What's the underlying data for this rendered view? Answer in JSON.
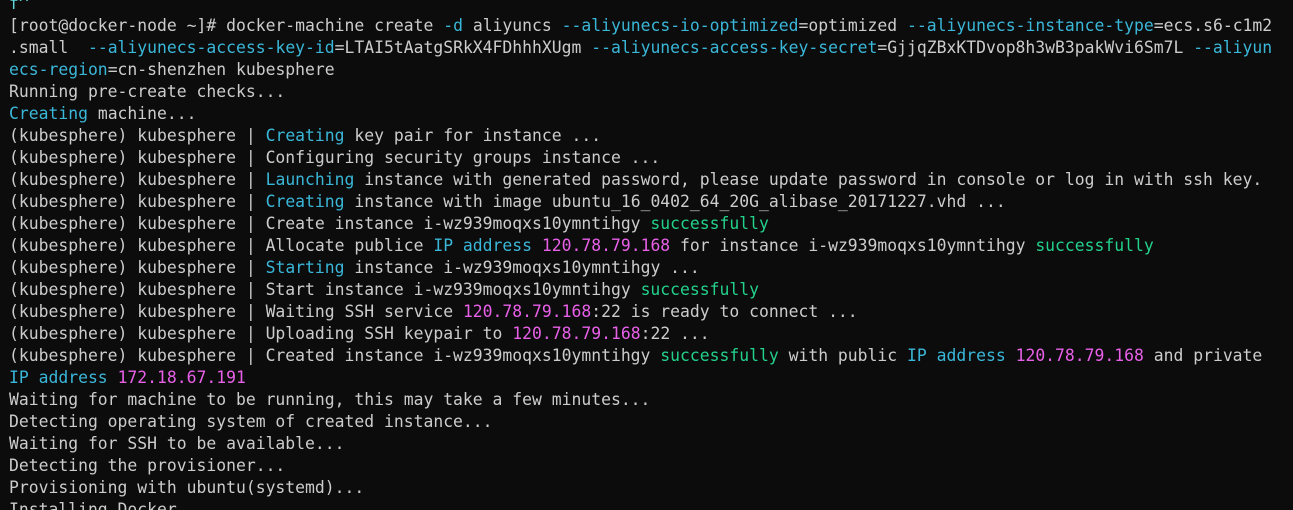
{
  "window": {
    "type": "terminal",
    "background": "#0c0c0c",
    "foreground": "#cccccc"
  },
  "colors": {
    "default": "#cccccc",
    "flag": "#3ab7d8",
    "keyword": "#3ab7d8",
    "success": "#23d18b",
    "ip": "#e860e8"
  },
  "lines": [
    [
      {
        "t": "f^",
        "c": "bcyan"
      }
    ],
    [
      {
        "t": "[root@docker-node ~]# docker-machine create ",
        "c": "default"
      },
      {
        "t": "-d",
        "c": "teal"
      },
      {
        "t": " aliyuncs ",
        "c": "default"
      },
      {
        "t": "--aliyunecs-io-optimized",
        "c": "teal"
      },
      {
        "t": "=optimized ",
        "c": "default"
      },
      {
        "t": "--aliyunecs-instance-type",
        "c": "teal"
      },
      {
        "t": "=ecs.s6-c1m2",
        "c": "default"
      }
    ],
    [
      {
        "t": ".small  ",
        "c": "default"
      },
      {
        "t": "--aliyunecs-access-key-id",
        "c": "teal"
      },
      {
        "t": "=LTAI5tAatgSRkX4FDhhhXUgm ",
        "c": "default"
      },
      {
        "t": "--aliyunecs-access-key-secret",
        "c": "teal"
      },
      {
        "t": "=GjjqZBxKTDvop8h3wB3pakWvi6Sm7L ",
        "c": "default"
      },
      {
        "t": "--aliyun",
        "c": "teal"
      }
    ],
    [
      {
        "t": "ecs-region",
        "c": "teal"
      },
      {
        "t": "=cn-shenzhen kubesphere",
        "c": "default"
      }
    ],
    [
      {
        "t": "Running pre-create checks...",
        "c": "default"
      }
    ],
    [
      {
        "t": "Creating",
        "c": "teal"
      },
      {
        "t": " machine...",
        "c": "default"
      }
    ],
    [
      {
        "t": "(kubesphere) kubesphere | ",
        "c": "default"
      },
      {
        "t": "Creating",
        "c": "teal"
      },
      {
        "t": " key pair for instance ...",
        "c": "default"
      }
    ],
    [
      {
        "t": "(kubesphere) kubesphere | Configuring security groups instance ...",
        "c": "default"
      }
    ],
    [
      {
        "t": "(kubesphere) kubesphere | ",
        "c": "default"
      },
      {
        "t": "Launching",
        "c": "teal"
      },
      {
        "t": " instance with generated password, please update password in console or log in with ssh key.",
        "c": "default"
      }
    ],
    [
      {
        "t": "(kubesphere) kubesphere | ",
        "c": "default"
      },
      {
        "t": "Creating",
        "c": "teal"
      },
      {
        "t": " instance with image ubuntu_16_0402_64_20G_alibase_20171227.vhd ...",
        "c": "default"
      }
    ],
    [
      {
        "t": "(kubesphere) kubesphere | Create instance i-wz939moqxs10ymntihgy ",
        "c": "default"
      },
      {
        "t": "successfully",
        "c": "lime"
      }
    ],
    [
      {
        "t": "(kubesphere) kubesphere | Allocate publice ",
        "c": "default"
      },
      {
        "t": "IP address",
        "c": "teal"
      },
      {
        "t": " ",
        "c": "default"
      },
      {
        "t": "120.78.79.168",
        "c": "bmagenta"
      },
      {
        "t": " for instance i-wz939moqxs10ymntihgy ",
        "c": "default"
      },
      {
        "t": "successfully",
        "c": "lime"
      }
    ],
    [
      {
        "t": "(kubesphere) kubesphere | ",
        "c": "default"
      },
      {
        "t": "Starting",
        "c": "teal"
      },
      {
        "t": " instance i-wz939moqxs10ymntihgy ...",
        "c": "default"
      }
    ],
    [
      {
        "t": "(kubesphere) kubesphere | Start instance i-wz939moqxs10ymntihgy ",
        "c": "default"
      },
      {
        "t": "successfully",
        "c": "lime"
      }
    ],
    [
      {
        "t": "(kubesphere) kubesphere | Waiting SSH service ",
        "c": "default"
      },
      {
        "t": "120.78.79.168",
        "c": "bmagenta"
      },
      {
        "t": ":22 is ready to connect ...",
        "c": "default"
      }
    ],
    [
      {
        "t": "(kubesphere) kubesphere | Uploading SSH keypair to ",
        "c": "default"
      },
      {
        "t": "120.78.79.168",
        "c": "bmagenta"
      },
      {
        "t": ":22 ...",
        "c": "default"
      }
    ],
    [
      {
        "t": "(kubesphere) kubesphere | Created instance i-wz939moqxs10ymntihgy ",
        "c": "default"
      },
      {
        "t": "successfully",
        "c": "lime"
      },
      {
        "t": " with public ",
        "c": "default"
      },
      {
        "t": "IP address",
        "c": "teal"
      },
      {
        "t": " ",
        "c": "default"
      },
      {
        "t": "120.78.79.168",
        "c": "bmagenta"
      },
      {
        "t": " and private",
        "c": "default"
      }
    ],
    [
      {
        "t": "IP address",
        "c": "teal"
      },
      {
        "t": " ",
        "c": "default"
      },
      {
        "t": "172.18.67.191",
        "c": "bmagenta"
      }
    ],
    [
      {
        "t": "Waiting for machine to be running, this may take a few minutes...",
        "c": "default"
      }
    ],
    [
      {
        "t": "Detecting operating system of created instance...",
        "c": "default"
      }
    ],
    [
      {
        "t": "Waiting for SSH to be available...",
        "c": "default"
      }
    ],
    [
      {
        "t": "Detecting the provisioner...",
        "c": "default"
      }
    ],
    [
      {
        "t": "Provisioning with ubuntu(systemd)...",
        "c": "default"
      }
    ],
    [
      {
        "t": "Installing Docker...",
        "c": "default"
      }
    ]
  ]
}
